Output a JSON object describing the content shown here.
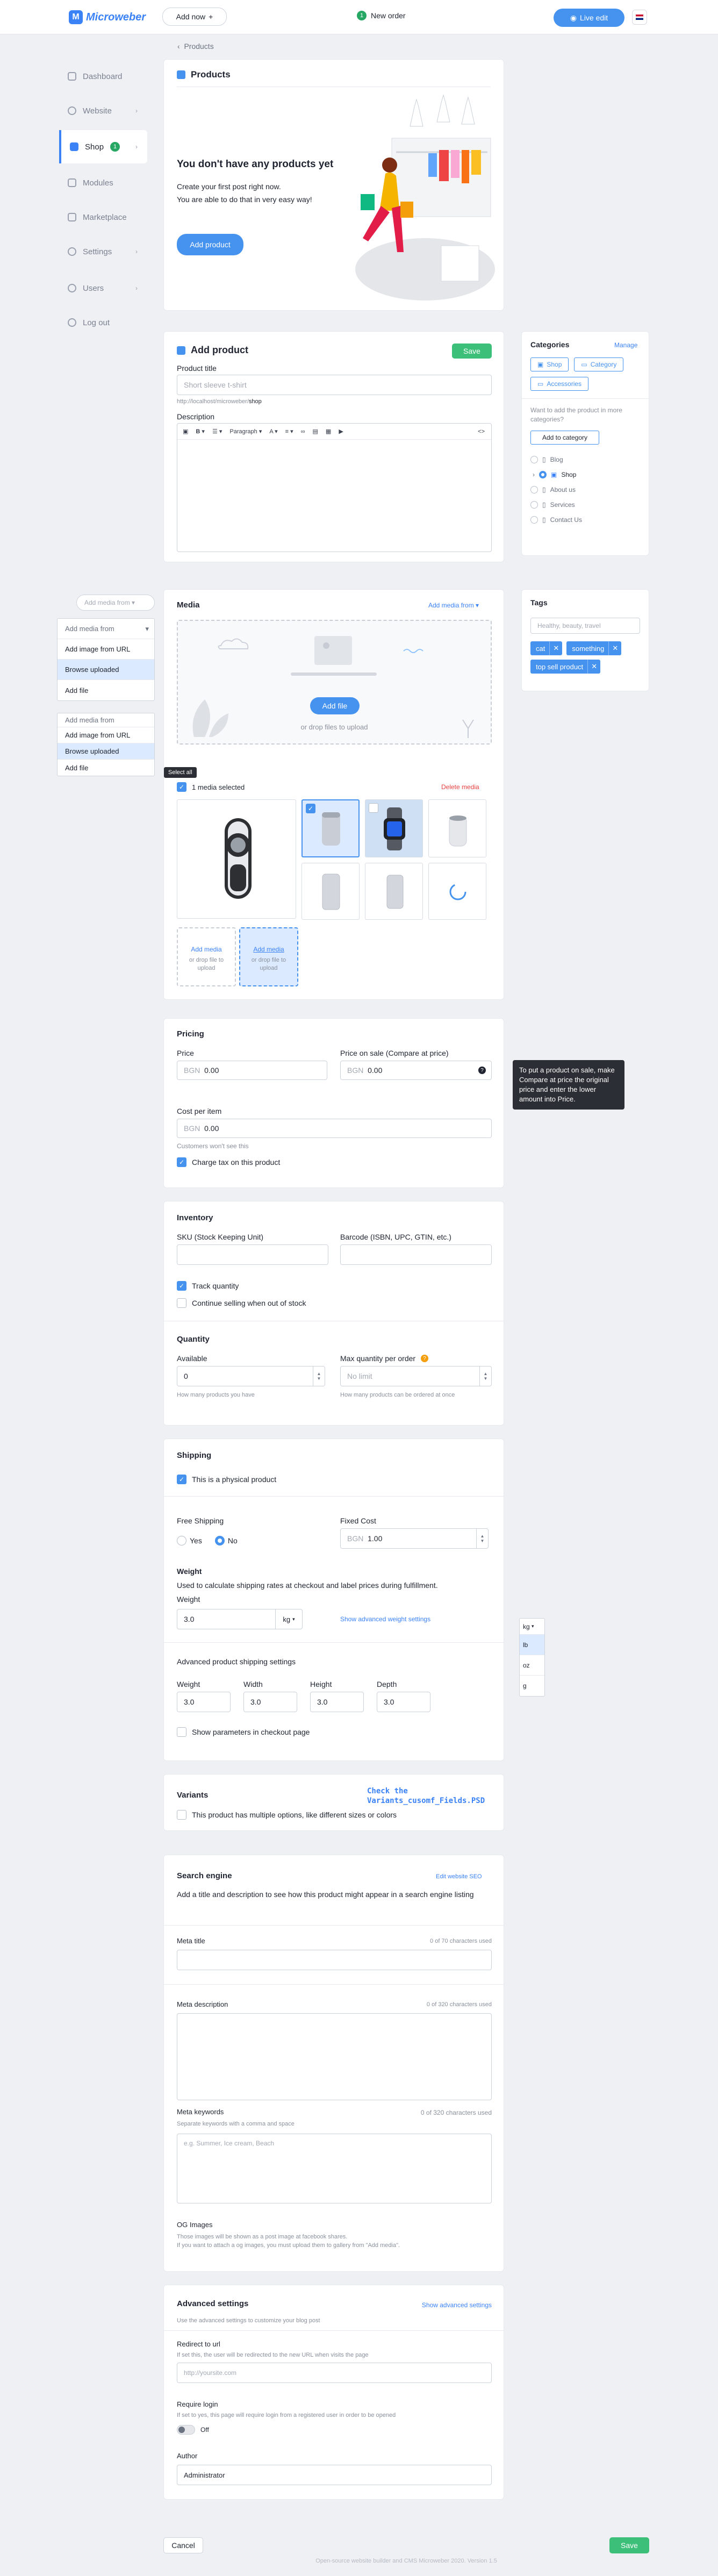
{
  "brand": {
    "name": "Microweber",
    "accent": "#3b82f6",
    "success": "#3cbf78"
  },
  "topbar": {
    "add_now": "Add now",
    "new_order_count": "1",
    "new_order": "New order",
    "live_edit": "Live edit"
  },
  "sidebar": {
    "items": [
      {
        "label": "Dashboard"
      },
      {
        "label": "Website"
      },
      {
        "label": "Shop",
        "count": "1"
      },
      {
        "label": "Modules"
      },
      {
        "label": "Marketplace"
      },
      {
        "label": "Settings"
      },
      {
        "label": "Users"
      },
      {
        "label": "Log out"
      }
    ]
  },
  "breadcrumb": {
    "label": "Products"
  },
  "empty": {
    "title": "Products",
    "heading": "You don't have any products yet",
    "line1": "Create your first post right now.",
    "line2": "You are able to do that in very easy way!",
    "button": "Add product"
  },
  "add_product": {
    "title": "Add product",
    "save": "Save",
    "product_title_label": "Product title",
    "product_title_placeholder": "Short sleeve t-shirt",
    "url_prefix": "http://localhost/microweber/",
    "url_slug": "shop",
    "description_label": "Description",
    "toolbar_paragraph": "Paragraph"
  },
  "categories": {
    "title": "Categories",
    "manage": "Manage",
    "tabs": [
      "Shop",
      "Category",
      "Accessories"
    ],
    "hint": "Want to add the product in more categories?",
    "add_button": "Add to category",
    "tree": [
      "Blog",
      "Shop",
      "About us",
      "Services",
      "Contact Us"
    ]
  },
  "tags": {
    "title": "Tags",
    "placeholder": "Healthy, beauty, travel",
    "items": [
      "cat",
      "something",
      "top sell product"
    ]
  },
  "media_dd1": {
    "header": "Add media from",
    "items": [
      "Add media from",
      "Add image from URL",
      "Browse uploaded",
      "Add file"
    ]
  },
  "media_dd2": {
    "items": [
      "Add media from",
      "Add image from URL",
      "Browse uploaded",
      "Add file"
    ]
  },
  "media": {
    "title": "Media",
    "add_from": "Add media from",
    "add_file": "Add file",
    "drop": "or drop files to upload",
    "select_all": "Select all",
    "selected": "1 media selected",
    "delete": "Delete media",
    "add_media": "Add media",
    "drop2": "or drop file to upload"
  },
  "pricing": {
    "title": "Pricing",
    "price_label": "Price",
    "price_cur": "BGN",
    "price_val": "0.00",
    "sale_label": "Price on sale (Compare at price)",
    "sale_cur": "BGN",
    "sale_val": "0.00",
    "tooltip": "To put a product on sale, make Compare at price the original price and enter the lower amount into Price.",
    "cost_label": "Cost per item",
    "cost_cur": "BGN",
    "cost_val": "0.00",
    "cost_hint": "Customers won't see this",
    "tax": "Charge tax on this product"
  },
  "inventory": {
    "title": "Inventory",
    "sku_label": "SKU (Stock Keeping Unit)",
    "barcode_label": "Barcode (ISBN, UPC, GTIN, etc.)",
    "track": "Track quantity",
    "continue": "Continue selling when out of stock",
    "qty_title": "Quantity",
    "available_label": "Available",
    "available_val": "0",
    "available_hint": "How many products you have",
    "max_label": "Max quantity per order",
    "max_placeholder": "No limit",
    "max_hint": "How many products can be ordered at once"
  },
  "shipping": {
    "title": "Shipping",
    "physical": "This is a physical product",
    "free_label": "Free Shipping",
    "yes": "Yes",
    "no": "No",
    "fixed_label": "Fixed Cost",
    "fixed_cur": "BGN",
    "fixed_val": "1.00",
    "weight_title": "Weight",
    "weight_desc": "Used to calculate shipping rates at checkout and label prices during fulfillment.",
    "weight_label": "Weight",
    "weight_val": "3.0",
    "unit": "kg",
    "show_adv": "Show advanced weight settings",
    "units": [
      "kg",
      "lb",
      "oz",
      "g"
    ],
    "adv_title": "Advanced product shipping settings",
    "dims": [
      {
        "label": "Weight",
        "val": "3.0"
      },
      {
        "label": "Width",
        "val": "3.0"
      },
      {
        "label": "Height",
        "val": "3.0"
      },
      {
        "label": "Depth",
        "val": "3.0"
      }
    ],
    "show_params": "Show parameters in checkout page"
  },
  "variants": {
    "title": "Variants",
    "file_note": "Check the Variants_cusomf_Fields.PSD",
    "multi": "This product has multiple options, like different sizes or colors"
  },
  "seo": {
    "title": "Search engine",
    "edit": "Edit website SEO",
    "desc": "Add a title and description to see how this product might appear in a search engine listing",
    "meta_title": "Meta title",
    "meta_title_count": "0 of 70 characters used",
    "meta_desc": "Meta description",
    "meta_desc_count": "0 of 320 characters used",
    "meta_kw": "Meta keywords",
    "meta_kw_count": "0 of 320 characters used",
    "meta_kw_hint": "Separate keywords with a comma and space",
    "meta_kw_placeholder": "e.g. Summer, Ice cream, Beach",
    "og_title": "OG Images",
    "og_line1": "Those images will be shown as a post image at facebook shares.",
    "og_line2": "If you want to attach a og images, you must upload them to gallery from \"Add media\"."
  },
  "advanced": {
    "title": "Advanced settings",
    "show": "Show advanced settings",
    "desc": "Use the advanced settings to customize your blog post",
    "redirect_label": "Redirect to url",
    "redirect_hint": "If set this, the user will be redirected to the new URL when visits the page",
    "redirect_placeholder": "http://yoursite.com",
    "login_label": "Require login",
    "login_hint": "If set to yes, this page will require login from a registered user in order to be opened",
    "toggle": "Off",
    "author_label": "Author",
    "author_val": "Administrator"
  },
  "footer": {
    "cancel": "Cancel",
    "save": "Save",
    "copyright": "Open-source website builder and CMS Microweber 2020. Version 1.5"
  }
}
